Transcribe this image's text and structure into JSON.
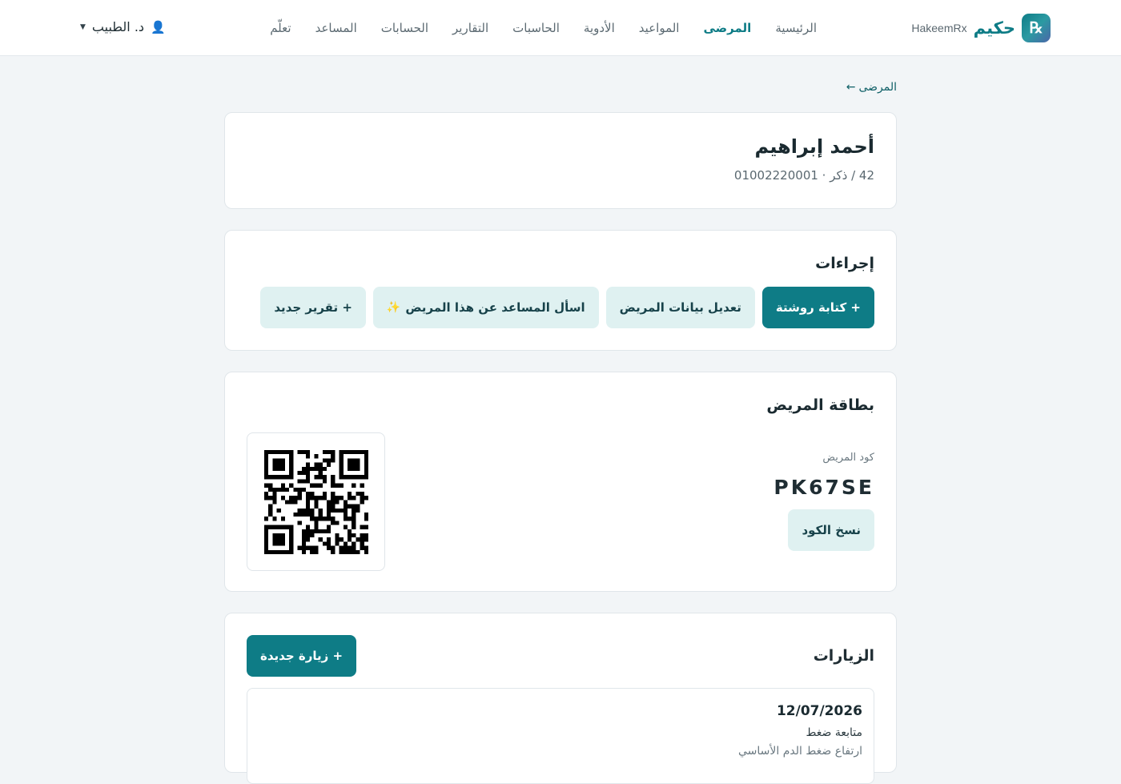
{
  "header": {
    "brand_ar": "حكيم",
    "brand_en": "HakeemRx",
    "logo_text": "℞",
    "nav": [
      {
        "label": "الرئيسية",
        "active": false
      },
      {
        "label": "المرضى",
        "active": true
      },
      {
        "label": "المواعيد",
        "active": false
      },
      {
        "label": "الأدوية",
        "active": false
      },
      {
        "label": "الحاسبات",
        "active": false
      },
      {
        "label": "التقارير",
        "active": false
      },
      {
        "label": "الحسابات",
        "active": false
      },
      {
        "label": "المساعد",
        "active": false
      },
      {
        "label": "تعلّم",
        "active": false
      }
    ],
    "user_name": "د. الطبيب",
    "user_icon": "person-icon"
  },
  "breadcrumb": {
    "arrow": "←",
    "label": "المرضى"
  },
  "patient": {
    "name": "أحمد إبراهيم",
    "meta": "42 / ذكر · 01002220001"
  },
  "actions": {
    "title": "إجراءات",
    "buttons": [
      {
        "label": "+ كتابة روشتة",
        "style": "primary"
      },
      {
        "label": "تعديل بيانات المريض",
        "style": "soft"
      },
      {
        "label": "اسأل المساعد عن هذا المريض",
        "style": "soft",
        "icon": "sparkle-icon",
        "glyph": "✨"
      },
      {
        "label": "+ تقرير جديد",
        "style": "soft"
      }
    ]
  },
  "patient_card": {
    "title": "بطاقة المريض",
    "code_label": "كود المريض",
    "code": "PK67SE",
    "copy_label": "نسخ الكود"
  },
  "visits": {
    "title": "الزيارات",
    "new_visit_label": "+ زيارة جديدة",
    "items": [
      {
        "date": "12/07/2026",
        "type": "متابعة ضغط",
        "note": "ارتفاع ضغط الدم الأساسي"
      }
    ]
  },
  "colors": {
    "primary": "#0e7c86",
    "soft": "#dff1f1",
    "background": "#f2f5f7"
  }
}
